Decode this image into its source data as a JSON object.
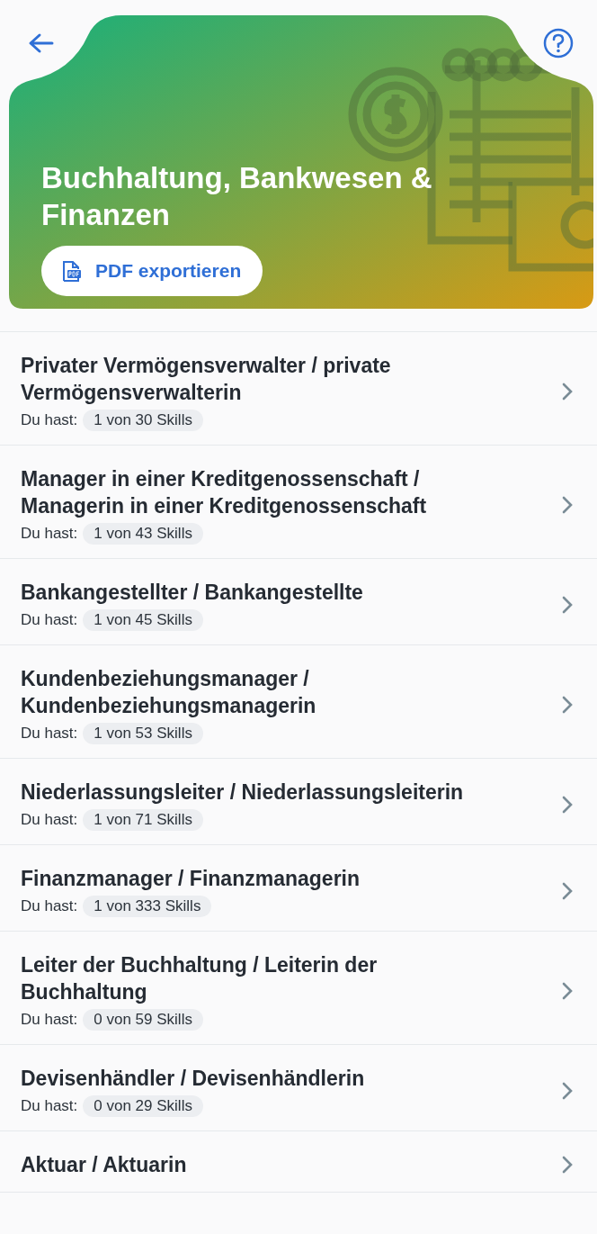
{
  "header": {
    "title": "Buchhaltung, Bankwesen & Finanzen",
    "export_button": "PDF exportieren"
  },
  "jobs": [
    {
      "title": "Privater Vermögensverwalter / private Vermögensverwalterin",
      "label": "Du hast:",
      "skills": "1 von 30 Skills"
    },
    {
      "title": "Manager in einer Kreditgenossenschaft / Managerin in einer Kreditgenossenschaft",
      "label": "Du hast:",
      "skills": "1 von 43 Skills"
    },
    {
      "title": "Bankangestellter / Bankangestellte",
      "label": "Du hast:",
      "skills": "1 von 45 Skills"
    },
    {
      "title": "Kundenbeziehungsmanager / Kundenbeziehungsmanagerin",
      "label": "Du hast:",
      "skills": "1 von 53 Skills"
    },
    {
      "title": "Niederlassungsleiter / Niederlassungsleiterin",
      "label": "Du hast:",
      "skills": "1 von 71 Skills"
    },
    {
      "title": "Finanzmanager / Finanzmanagerin",
      "label": "Du hast:",
      "skills": "1 von 333 Skills"
    },
    {
      "title": "Leiter der Buchhaltung / Leiterin der Buchhaltung",
      "label": "Du hast:",
      "skills": "0 von 59 Skills"
    },
    {
      "title": "Devisenhändler / Devisenhändlerin",
      "label": "Du hast:",
      "skills": "0 von 29 Skills"
    },
    {
      "title": "Aktuar / Aktuarin"
    }
  ]
}
